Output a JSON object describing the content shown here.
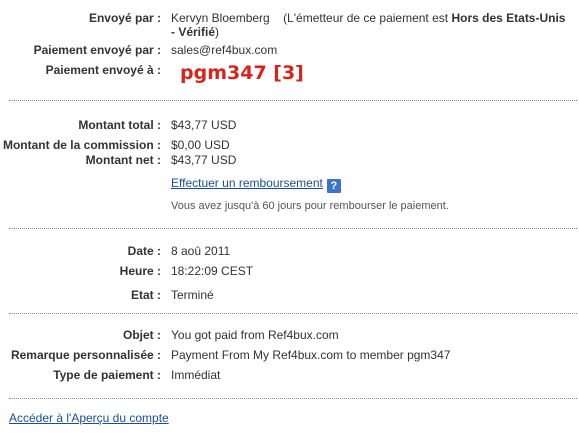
{
  "sender": {
    "label": "Envoyé par :",
    "name": "Kervyn Bloemberg",
    "note_open": "(L'émetteur de ce paiement est ",
    "note_status": "Hors des Etats-Unis - Vérifié",
    "note_close": ")"
  },
  "sent_by": {
    "label": "Paiement envoyé par :",
    "value": "sales@ref4bux.com"
  },
  "sent_to": {
    "label": "Paiement envoyé à :",
    "value": "pgm347 [3]"
  },
  "amounts": {
    "total_label": "Montant total :",
    "total_value": "$43,77 USD",
    "fee_label": "Montant de la commission :",
    "fee_value": "$0,00 USD",
    "net_label": "Montant net :",
    "net_value": "$43,77 USD",
    "refund_link": "Effectuer un remboursement",
    "help_icon": "?",
    "refund_note": "Vous avez jusqu'à 60 jours pour rembourser le paiement."
  },
  "details": {
    "date_label": "Date :",
    "date_value": "8 aoû 2011",
    "time_label": "Heure :",
    "time_value": "18:22:09 CEST",
    "status_label": "Etat :",
    "status_value": "Terminé"
  },
  "message": {
    "subject_label": "Objet :",
    "subject_value": "You got paid from Ref4bux.com",
    "note_label": "Remarque personnalisée :",
    "note_value": "Payment From My Ref4bux.com to member pgm347",
    "type_label": "Type de paiement :",
    "type_value": "Immédiat"
  },
  "footer": {
    "overview_link": "Accéder à l'Aperçu du compte"
  },
  "colors": {
    "link": "#1a4d99",
    "highlight_red": "#d9241c",
    "help_icon_bg": "#3d75c6"
  }
}
